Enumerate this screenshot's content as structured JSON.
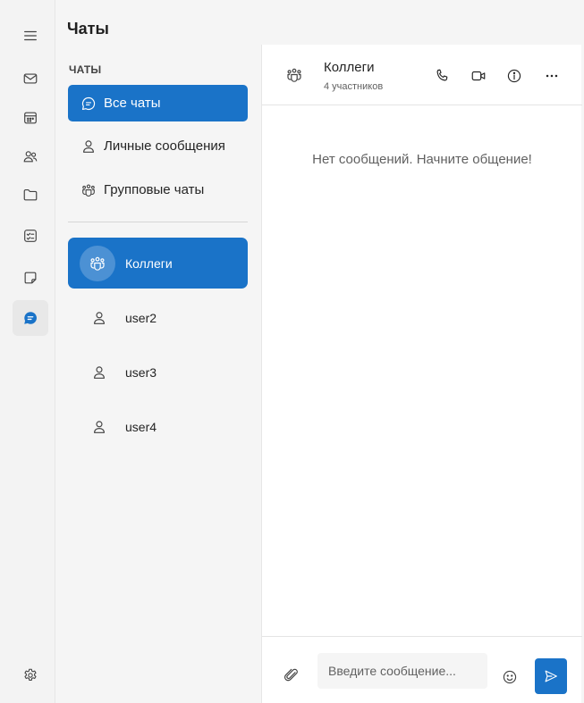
{
  "rail": {
    "items": [
      {
        "icon": "hamburger-menu-icon"
      },
      {
        "icon": "mail-icon"
      },
      {
        "icon": "calendar-icon"
      },
      {
        "icon": "people-icon"
      },
      {
        "icon": "folder-icon"
      },
      {
        "icon": "tasks-icon"
      },
      {
        "icon": "note-icon"
      },
      {
        "icon": "chat-icon",
        "active": true
      },
      {
        "icon": "settings-icon"
      }
    ]
  },
  "sidebar": {
    "title": "Чаты",
    "section_label": "ЧАТЫ",
    "filters": [
      {
        "label": "Все чаты",
        "icon": "chat-bubble-icon",
        "active": true
      },
      {
        "label": "Личные сообщения",
        "icon": "person-icon",
        "active": false
      },
      {
        "label": "Групповые чаты",
        "icon": "group-icon",
        "active": false
      }
    ],
    "chats": [
      {
        "name": "Коллеги",
        "icon": "group-icon",
        "active": true
      },
      {
        "name": "user2",
        "icon": "person-icon",
        "active": false
      },
      {
        "name": "user3",
        "icon": "person-icon",
        "active": false
      },
      {
        "name": "user4",
        "icon": "person-icon",
        "active": false
      }
    ]
  },
  "chat": {
    "title": "Коллеги",
    "subtitle": "4 участников",
    "empty_text": "Нет сообщений. Начните общение!",
    "actions": [
      "phone-icon",
      "video-icon",
      "info-icon",
      "more-icon"
    ]
  },
  "composer": {
    "placeholder": "Введите сообщение...",
    "value": ""
  },
  "colors": {
    "accent": "#1a73c8",
    "background": "#f5f5f5",
    "panel": "#ffffff"
  }
}
